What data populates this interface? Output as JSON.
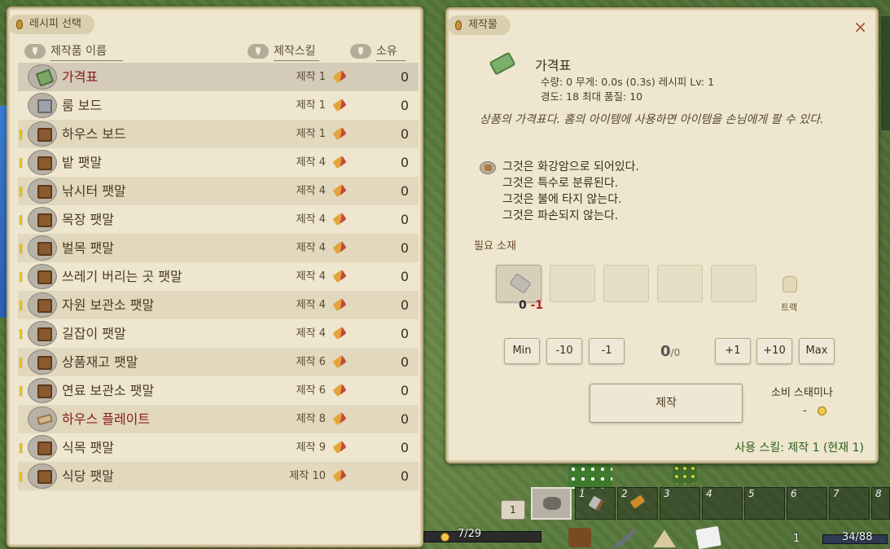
{
  "left_panel": {
    "title": "레시피 선택",
    "columns": {
      "name": "제작품 이름",
      "skill": "제작스킬",
      "owned": "소유"
    },
    "recipes": [
      {
        "name": "가격표",
        "skill": "제작 1",
        "count": "0",
        "alert": false,
        "name_color": "red",
        "icon": "price-tag-icon",
        "selected": true
      },
      {
        "name": "룸 보드",
        "skill": "제작 1",
        "count": "0",
        "alert": false,
        "name_color": "normal",
        "icon": "room-board-icon"
      },
      {
        "name": "하우스 보드",
        "skill": "제작 1",
        "count": "0",
        "alert": true,
        "name_color": "normal",
        "icon": "house-board-icon"
      },
      {
        "name": "밭 팻말",
        "skill": "제작 4",
        "count": "0",
        "alert": true,
        "name_color": "normal",
        "icon": "sign-icon"
      },
      {
        "name": "낚시터 팻말",
        "skill": "제작 4",
        "count": "0",
        "alert": true,
        "name_color": "normal",
        "icon": "sign-icon"
      },
      {
        "name": "목장 팻말",
        "skill": "제작 4",
        "count": "0",
        "alert": true,
        "name_color": "normal",
        "icon": "sign-icon"
      },
      {
        "name": "벌목 팻말",
        "skill": "제작 4",
        "count": "0",
        "alert": true,
        "name_color": "normal",
        "icon": "sign-icon"
      },
      {
        "name": "쓰레기 버리는 곳 팻말",
        "skill": "제작 4",
        "count": "0",
        "alert": true,
        "name_color": "normal",
        "icon": "sign-icon"
      },
      {
        "name": "자원 보관소 팻말",
        "skill": "제작 4",
        "count": "0",
        "alert": true,
        "name_color": "normal",
        "icon": "sign-icon"
      },
      {
        "name": "길잡이 팻말",
        "skill": "제작 4",
        "count": "0",
        "alert": true,
        "name_color": "normal",
        "icon": "sign-icon"
      },
      {
        "name": "상품재고 팻말",
        "skill": "제작 6",
        "count": "0",
        "alert": true,
        "name_color": "normal",
        "icon": "sign-icon"
      },
      {
        "name": "연료 보관소 팻말",
        "skill": "제작 6",
        "count": "0",
        "alert": true,
        "name_color": "normal",
        "icon": "sign-icon"
      },
      {
        "name": "하우스 플레이트",
        "skill": "제작 8",
        "count": "0",
        "alert": false,
        "name_color": "red",
        "icon": "plate-icon"
      },
      {
        "name": "식목 팻말",
        "skill": "제작 9",
        "count": "0",
        "alert": true,
        "name_color": "normal",
        "icon": "sign-icon"
      },
      {
        "name": "식당 팻말",
        "skill": "제작 10",
        "count": "0",
        "alert": true,
        "name_color": "normal",
        "icon": "sign-icon"
      }
    ]
  },
  "right_panel": {
    "title": "제작물",
    "close": "×",
    "item": {
      "name": "가격표",
      "stats_line1": "수량: 0 무게: 0.0s (0.3s)  레시피 Lv: 1",
      "stats_line2": "경도: 18  최대 품질: 10",
      "description": "상품의 가격표다. 홈의 아이템에 사용하면 아이템을 손님에게 팔 수 있다.",
      "properties": [
        "그것은 화강암으로 되어있다.",
        "그것은 특수로 분류된다.",
        "그것은 불에 타지 않는다.",
        "그것은 파손되지 않는다."
      ]
    },
    "materials_label": "필요 소재",
    "material_count": "0",
    "material_need": "-1",
    "truck_label": "트랙",
    "qty_buttons": {
      "min": "Min",
      "m10": "-10",
      "m1": "-1",
      "p1": "+1",
      "p10": "+10",
      "max": "Max"
    },
    "qty_current": "0",
    "qty_total": "/0",
    "craft_label": "제작",
    "stamina_label": "소비 스태미나",
    "stamina_value": "-",
    "used_skill": "사용 스킬: 제작 1 (현재 1)"
  },
  "hotbar": {
    "page": "1",
    "slots": [
      "1",
      "2",
      "3",
      "4",
      "5",
      "6",
      "7",
      "8"
    ]
  },
  "status": {
    "time": "7/29",
    "weight_count": "1",
    "weight": "34/88"
  }
}
